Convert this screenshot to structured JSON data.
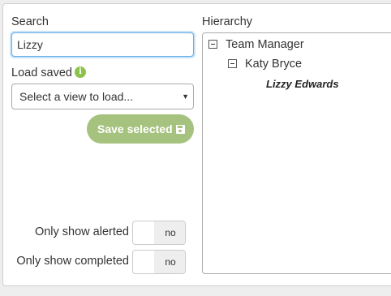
{
  "search": {
    "label": "Search",
    "value": "Lizzy"
  },
  "load_saved": {
    "label": "Load saved",
    "icon": "info-icon",
    "selected": "Select a view to load..."
  },
  "save_button": {
    "label": "Save selected",
    "icon": "floppy-disk-icon",
    "color": "#a5c27e"
  },
  "toggles": [
    {
      "label": "Only show alerted",
      "state": "no"
    },
    {
      "label": "Only show completed",
      "state": "no"
    }
  ],
  "hierarchy": {
    "label": "Hierarchy",
    "nodes": [
      {
        "label": "Team Manager",
        "expanded": true
      },
      {
        "label": "Katy Bryce",
        "expanded": true
      },
      {
        "label": "Lizzy Edwards"
      }
    ]
  }
}
